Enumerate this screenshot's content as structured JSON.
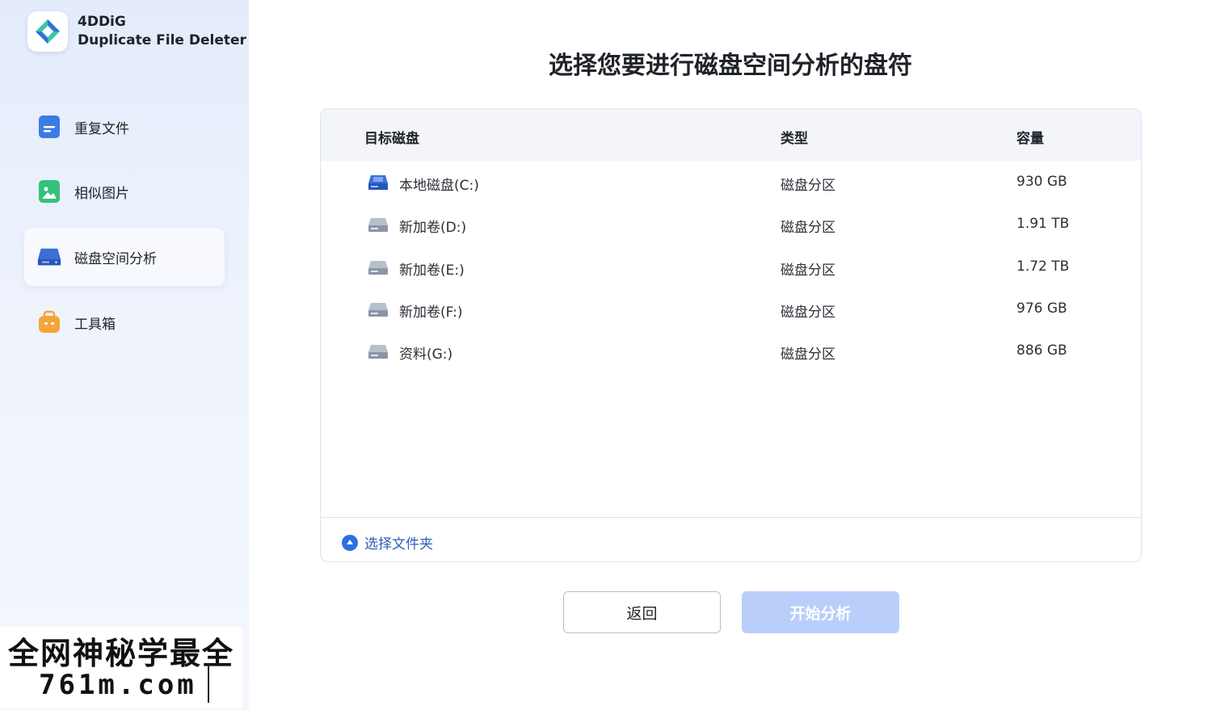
{
  "app": {
    "brand_name": "4DDiG",
    "brand_subtitle": "Duplicate File Deleter"
  },
  "sidebar": {
    "items": [
      {
        "label": "重复文件",
        "icon": "document-icon",
        "active": false
      },
      {
        "label": "相似图片",
        "icon": "image-icon",
        "active": false
      },
      {
        "label": "磁盘空间分析",
        "icon": "disk-icon",
        "active": true
      },
      {
        "label": "工具箱",
        "icon": "toolbox-icon",
        "active": false
      }
    ]
  },
  "watermark": {
    "line1": "全网神秘学最全",
    "line2": "761m.com"
  },
  "main": {
    "title": "选择您要进行磁盘空间分析的盘符",
    "table": {
      "headers": [
        "目标磁盘",
        "类型",
        "容量"
      ],
      "rows": [
        {
          "name": "本地磁盘(C:)",
          "type": "磁盘分区",
          "capacity": "930 GB",
          "icon": "system-drive-icon"
        },
        {
          "name": "新加卷(D:)",
          "type": "磁盘分区",
          "capacity": "1.91 TB",
          "icon": "drive-icon"
        },
        {
          "name": "新加卷(E:)",
          "type": "磁盘分区",
          "capacity": "1.72 TB",
          "icon": "drive-icon"
        },
        {
          "name": "新加卷(F:)",
          "type": "磁盘分区",
          "capacity": "976 GB",
          "icon": "drive-icon"
        },
        {
          "name": "资料(G:)",
          "type": "磁盘分区",
          "capacity": "886 GB",
          "icon": "drive-icon"
        }
      ]
    },
    "select_folder_label": "选择文件夹",
    "back_button": "返回",
    "start_button": "开始分析"
  },
  "colors": {
    "accent": "#2e6fe0",
    "start_button_disabled": "#b9cffa"
  }
}
